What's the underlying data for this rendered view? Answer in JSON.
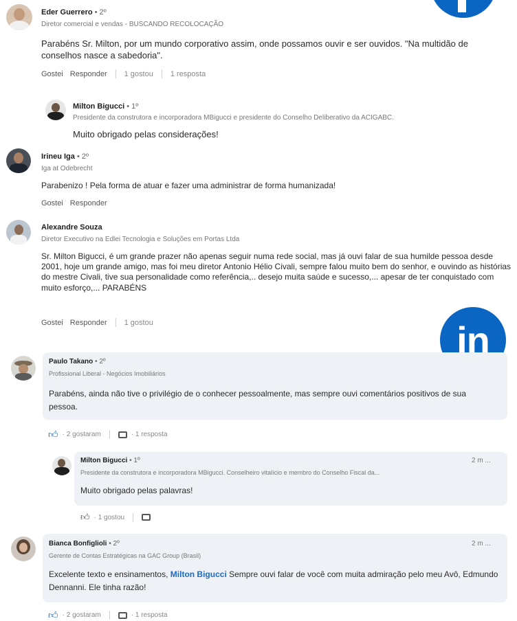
{
  "brand": {
    "color": "#0a66c2",
    "logo_text": "in"
  },
  "comments": [
    {
      "name": "Eder Guerrero",
      "degree": " • 2º",
      "headline": "Diretor comercial e vendas - BUSCANDO RECOLOCAÇÃO",
      "text": "Parabéns Sr. Milton, por um mundo corporativo assim, onde possamos ouvir e ser ouvidos. \"Na multidão de conselhos nasce a sabedoria\".",
      "like": "Gostei",
      "reply": "Responder",
      "likes": "1 gostou",
      "replies": "1 resposta",
      "reply_item": {
        "name": "Milton Bigucci",
        "degree": " • 1º",
        "headline": "Presidente da construtora e incorporadora MBigucci e presidente do Conselho Deliberativo da ACIGABC.",
        "text": "Muito obrigado pelas considerações!"
      }
    },
    {
      "name": "Irineu Iga",
      "degree": " • 2º",
      "headline": "Iga at Odebrecht",
      "text": "Parabenizo ! Pela forma de atuar e fazer uma administrar de forma humanizada!",
      "like": "Gostei",
      "reply": "Responder"
    },
    {
      "name": "Alexandre Souza",
      "degree": "",
      "headline": "Diretor Executivo na Edlei Tecnologia e Soluções em Portas Ltda",
      "text": "Sr. Milton Bigucci, é  um grande prazer não apenas seguir numa rede social, mas já ouvi falar de sua humilde pessoa desde 2001, hoje um grande amigo, mas foi meu diretor Antonio Hélio Civali, sempre falou muito bem do senhor, e ouvindo as histórias do mestre Civali, tive sua personalidade como referência,.. desejo muita saúde e sucesso,... apesar de ter conquistado com muito esforço,... PARABÉNS",
      "like": "Gostei",
      "reply": "Responder",
      "likes": "1 gostou"
    },
    {
      "name": "Paulo Takano",
      "degree": " • 2º",
      "headline": "Profissional Liberal - Negócios Imobiliários",
      "text": "Parabéns, ainda não tive o privilégio de o conhecer pessoalmente, mas sempre ouvi comentários positivos de sua pessoa.",
      "likes": "· 2 gostaram",
      "replies": "· 1 resposta",
      "reply_item": {
        "name": "Milton Bigucci",
        "degree": " • 1º",
        "headline": "Presidente da construtora e incorporadora MBigucci. Conselheiro vitalício e membro do Conselho Fiscal da...",
        "time": "2 m  ...",
        "text": "Muito obrigado pelas palavras!",
        "likes": "· 1 gostou"
      }
    },
    {
      "name": "Bianca Bonfiglioli",
      "degree": " • 2º",
      "headline": "Gerente de Contas Estratégicas na GAC Group (Brasil)",
      "time": "2 m  ...",
      "text_before": "Excelente texto e ensinamentos, ",
      "mention": "Milton Bigucci",
      "text_after": "  Sempre ouvi falar de você com muita admiração pelo meu Avô, Edmundo Dennanni. Ele tinha razão!",
      "likes": "· 2 gostaram",
      "replies": "· 1 resposta"
    }
  ]
}
